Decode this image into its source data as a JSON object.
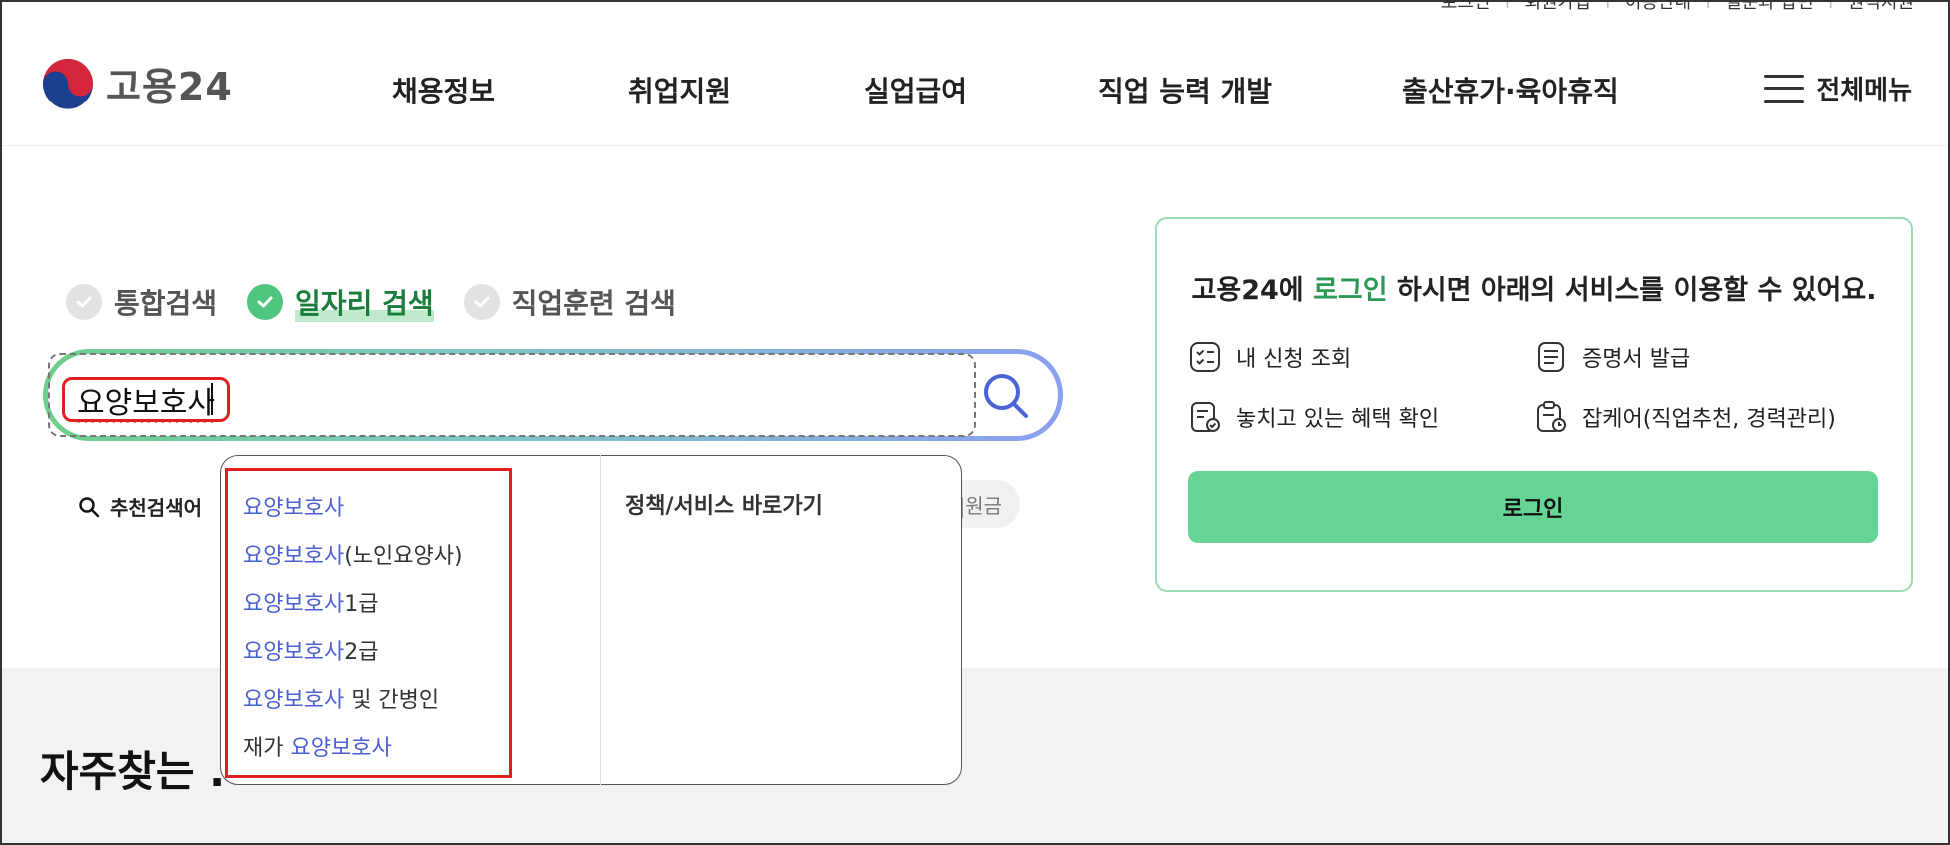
{
  "util_links": [
    "로그인",
    "회원가입",
    "이용안내",
    "질문과 답변",
    "원격지원"
  ],
  "logo": {
    "text": "고용24"
  },
  "nav": {
    "items": [
      "채용정보",
      "취업지원",
      "실업급여",
      "직업 능력 개발",
      "출산휴가·육아휴직"
    ],
    "all_menu": "전체메뉴"
  },
  "search": {
    "tabs": [
      {
        "label": "통합검색",
        "active": false
      },
      {
        "label": "일자리 검색",
        "active": true
      },
      {
        "label": "직업훈련 검색",
        "active": false
      }
    ],
    "query": "요양보호사",
    "recommend_label": "추천검색어",
    "recommend_chip": "|원금",
    "autocomplete": [
      {
        "highlight": "요양보호사",
        "suffix": "(노인요양사)",
        "prefix": ""
      },
      {
        "highlight": "요양보호사",
        "suffix": "",
        "prefix": ""
      },
      {
        "highlight": "요양보호사",
        "suffix": "1급",
        "prefix": ""
      },
      {
        "highlight": "요양보호사",
        "suffix": "2급",
        "prefix": ""
      },
      {
        "highlight": "요양보호사",
        "suffix": " 및 간병인",
        "prefix": ""
      },
      {
        "highlight": "요양보호사",
        "suffix": "",
        "prefix": "재가 "
      }
    ],
    "shortcut_title": "정책/서비스 바로가기"
  },
  "login_card": {
    "title_pre": "고용24에 ",
    "title_green": "로그인",
    "title_post": " 하시면 아래의 서비스를 이용할 수 있어요.",
    "services": [
      "내 신청 조회",
      "증명서 발급",
      "놓치고 있는 혜택 확인",
      "잡케어(직업추천, 경력관리)"
    ],
    "button": "로그인"
  },
  "faq_title": "자주찾는 .",
  "colors": {
    "accent_green": "#65d494",
    "highlight_blue": "#4b5fd0",
    "annotation_red": "#e02020"
  }
}
